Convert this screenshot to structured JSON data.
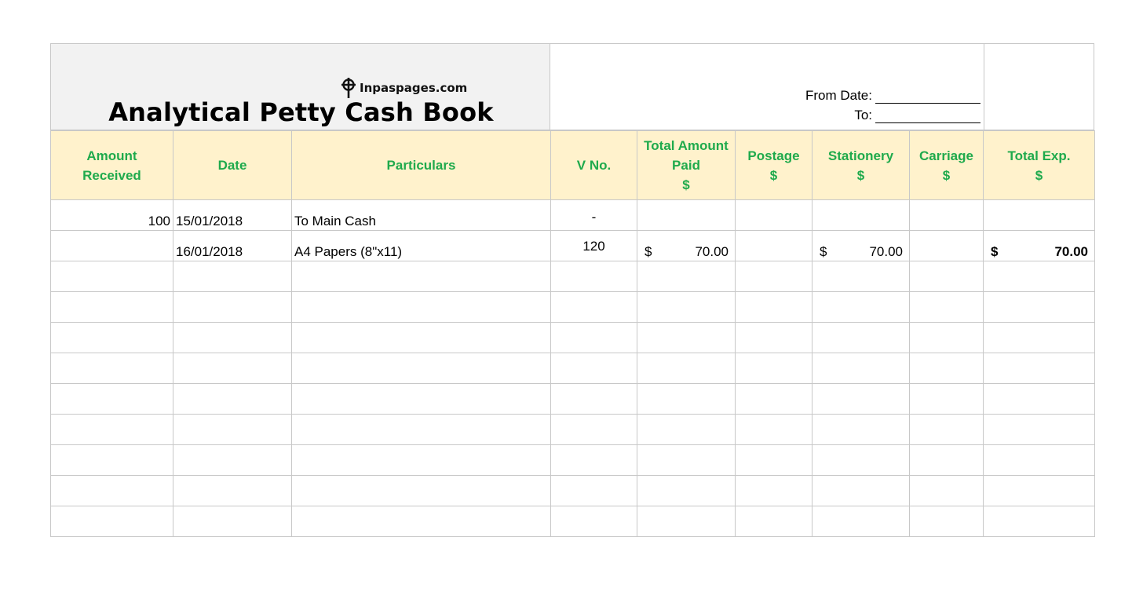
{
  "brand": {
    "name": "Inpaspages.com",
    "icon": "cross-target-logo-icon"
  },
  "title": "Analytical Petty Cash Book",
  "date_fields": {
    "from_label": "From Date:",
    "to_label": "To:"
  },
  "columns": [
    [
      "Amount",
      "Received"
    ],
    [
      "Date"
    ],
    [
      "Particulars"
    ],
    [
      "V No."
    ],
    [
      "Total Amount",
      "Paid",
      "$"
    ],
    [
      "Postage",
      "$"
    ],
    [
      "Stationery",
      "$"
    ],
    [
      "Carriage",
      "$"
    ],
    [
      "Total Exp.",
      "$"
    ]
  ],
  "rows": [
    {
      "amount_received": "100",
      "date": "15/01/2018",
      "particulars": "To Main Cash",
      "v_no": "-",
      "total_paid_sym": "",
      "total_paid": "",
      "postage": "",
      "stationery_sym": "",
      "stationery": "",
      "carriage": "",
      "total_exp_sym": "",
      "total_exp": ""
    },
    {
      "amount_received": "",
      "date": "16/01/2018",
      "particulars": "A4 Papers (8\"x11)",
      "v_no": "120",
      "total_paid_sym": "$",
      "total_paid": "70.00",
      "postage": "",
      "stationery_sym": "$",
      "stationery": "70.00",
      "carriage": "",
      "total_exp_sym": "$",
      "total_exp": "70.00"
    }
  ],
  "empty_rows": 9,
  "colors": {
    "header_bg": "#fff2cc",
    "header_text": "#1faa4c",
    "title_bg": "#f2f2f2",
    "grid_line": "#c8c8c8"
  }
}
